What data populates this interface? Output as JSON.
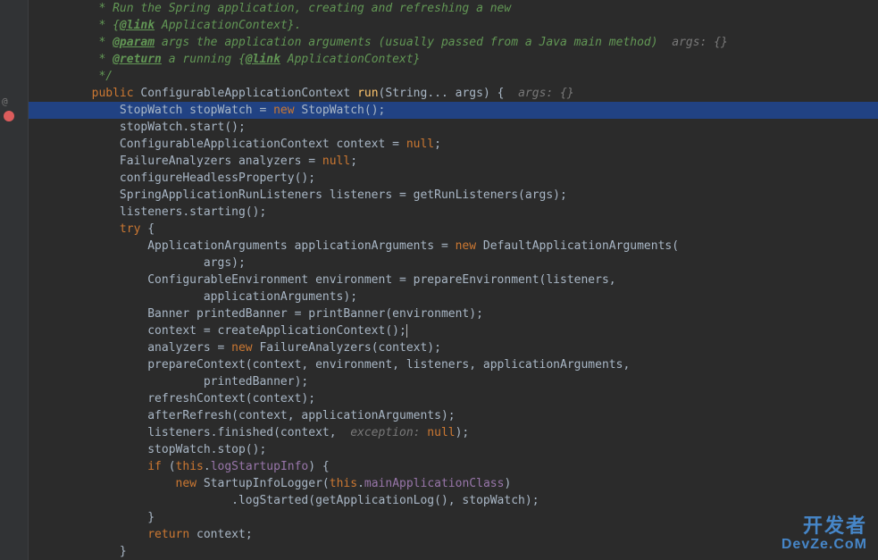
{
  "watermark": {
    "line1": "开发者",
    "line2": "DevZe.CoM"
  },
  "code": {
    "lines": [
      {
        "tokens": [
          {
            "t": "         * Run the Spring application, creating and refreshing a new",
            "c": "javadoc"
          }
        ]
      },
      {
        "tokens": [
          {
            "t": "         * {",
            "c": "javadoc"
          },
          {
            "t": "@link",
            "c": "javadoc-link"
          },
          {
            "t": " ApplicationContext}.",
            "c": "javadoc"
          }
        ]
      },
      {
        "tokens": [
          {
            "t": "         * ",
            "c": "javadoc"
          },
          {
            "t": "@param",
            "c": "javadoc-tag"
          },
          {
            "t": " args the application arguments (usually passed from a Java main method)  ",
            "c": "javadoc"
          },
          {
            "t": "args: {}",
            "c": "param-hint"
          }
        ]
      },
      {
        "tokens": [
          {
            "t": "         * ",
            "c": "javadoc"
          },
          {
            "t": "@return",
            "c": "javadoc-tag"
          },
          {
            "t": " a running {",
            "c": "javadoc"
          },
          {
            "t": "@link",
            "c": "javadoc-link"
          },
          {
            "t": " ApplicationContext}",
            "c": "javadoc"
          }
        ]
      },
      {
        "tokens": [
          {
            "t": "         */",
            "c": "javadoc"
          }
        ]
      },
      {
        "tokens": [
          {
            "t": "        ",
            "c": ""
          },
          {
            "t": "public ",
            "c": "keyword"
          },
          {
            "t": "ConfigurableApplicationContext ",
            "c": "type"
          },
          {
            "t": "run",
            "c": "method-decl"
          },
          {
            "t": "(String... args) {  ",
            "c": ""
          },
          {
            "t": "args: {}",
            "c": "param-hint"
          }
        ]
      },
      {
        "hl": true,
        "tokens": [
          {
            "t": "            StopWatch stopWatch = ",
            "c": ""
          },
          {
            "t": "new ",
            "c": "keyword"
          },
          {
            "t": "StopWatch();",
            "c": ""
          }
        ]
      },
      {
        "tokens": [
          {
            "t": "            stopWatch.start();",
            "c": ""
          }
        ]
      },
      {
        "tokens": [
          {
            "t": "            ConfigurableApplicationContext context = ",
            "c": ""
          },
          {
            "t": "null",
            "c": "keyword"
          },
          {
            "t": ";",
            "c": ""
          }
        ]
      },
      {
        "tokens": [
          {
            "t": "            FailureAnalyzers analyzers = ",
            "c": ""
          },
          {
            "t": "null",
            "c": "keyword"
          },
          {
            "t": ";",
            "c": ""
          }
        ]
      },
      {
        "tokens": [
          {
            "t": "            configureHeadlessProperty();",
            "c": ""
          }
        ]
      },
      {
        "tokens": [
          {
            "t": "            SpringApplicationRunListeners listeners = getRunListeners(args);",
            "c": ""
          }
        ]
      },
      {
        "tokens": [
          {
            "t": "            listeners.starting();",
            "c": ""
          }
        ]
      },
      {
        "tokens": [
          {
            "t": "            ",
            "c": ""
          },
          {
            "t": "try ",
            "c": "keyword"
          },
          {
            "t": "{",
            "c": ""
          }
        ]
      },
      {
        "tokens": [
          {
            "t": "                ApplicationArguments applicationArguments = ",
            "c": ""
          },
          {
            "t": "new ",
            "c": "keyword"
          },
          {
            "t": "DefaultApplicationArguments(",
            "c": ""
          }
        ]
      },
      {
        "tokens": [
          {
            "t": "                        args);",
            "c": ""
          }
        ]
      },
      {
        "tokens": [
          {
            "t": "                ConfigurableEnvironment environment = prepareEnvironment(listeners,",
            "c": ""
          }
        ]
      },
      {
        "tokens": [
          {
            "t": "                        applicationArguments);",
            "c": ""
          }
        ]
      },
      {
        "tokens": [
          {
            "t": "                Banner printedBanner = printBanner(environment);",
            "c": ""
          }
        ]
      },
      {
        "tokens": [
          {
            "t": "                context = createApplicationContext();",
            "c": ""
          },
          {
            "t": "",
            "c": "cursor-pos"
          }
        ]
      },
      {
        "tokens": [
          {
            "t": "                analyzers = ",
            "c": ""
          },
          {
            "t": "new ",
            "c": "keyword"
          },
          {
            "t": "FailureAnalyzers(context);",
            "c": ""
          }
        ]
      },
      {
        "tokens": [
          {
            "t": "                prepareContext(context, environment, listeners, applicationArguments,",
            "c": ""
          }
        ]
      },
      {
        "tokens": [
          {
            "t": "                        printedBanner);",
            "c": ""
          }
        ]
      },
      {
        "tokens": [
          {
            "t": "                refreshContext(context);",
            "c": ""
          }
        ]
      },
      {
        "tokens": [
          {
            "t": "                afterRefresh(context, applicationArguments);",
            "c": ""
          }
        ]
      },
      {
        "tokens": [
          {
            "t": "                listeners.finished(context, ",
            "c": ""
          },
          {
            "t": " exception: ",
            "c": "param-hint"
          },
          {
            "t": "null",
            "c": "keyword"
          },
          {
            "t": ");",
            "c": ""
          }
        ]
      },
      {
        "tokens": [
          {
            "t": "                stopWatch.stop();",
            "c": ""
          }
        ]
      },
      {
        "tokens": [
          {
            "t": "                ",
            "c": ""
          },
          {
            "t": "if ",
            "c": "keyword"
          },
          {
            "t": "(",
            "c": ""
          },
          {
            "t": "this",
            "c": "keyword"
          },
          {
            "t": ".",
            "c": ""
          },
          {
            "t": "logStartupInfo",
            "c": "field"
          },
          {
            "t": ") {",
            "c": ""
          }
        ]
      },
      {
        "tokens": [
          {
            "t": "                    ",
            "c": ""
          },
          {
            "t": "new ",
            "c": "keyword"
          },
          {
            "t": "StartupInfoLogger(",
            "c": ""
          },
          {
            "t": "this",
            "c": "keyword"
          },
          {
            "t": ".",
            "c": ""
          },
          {
            "t": "mainApplicationClass",
            "c": "field"
          },
          {
            "t": ")",
            "c": ""
          }
        ]
      },
      {
        "tokens": [
          {
            "t": "                            .logStarted(getApplicationLog(), stopWatch);",
            "c": ""
          }
        ]
      },
      {
        "tokens": [
          {
            "t": "                }",
            "c": ""
          }
        ]
      },
      {
        "tokens": [
          {
            "t": "                ",
            "c": ""
          },
          {
            "t": "return ",
            "c": "keyword"
          },
          {
            "t": "context;",
            "c": ""
          }
        ]
      },
      {
        "tokens": [
          {
            "t": "            }",
            "c": ""
          }
        ]
      }
    ]
  }
}
